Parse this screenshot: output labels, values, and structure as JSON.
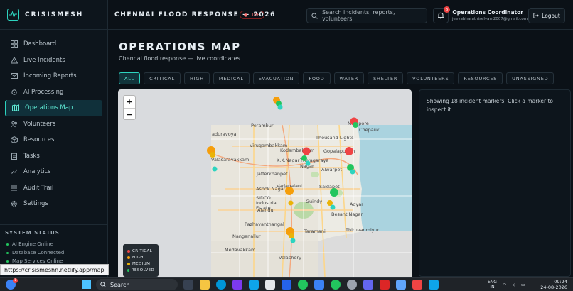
{
  "brand": {
    "name": "CRISISMESH"
  },
  "sidebar": {
    "items": [
      {
        "label": "Dashboard",
        "icon": "grid-icon"
      },
      {
        "label": "Live Incidents",
        "icon": "alert-icon"
      },
      {
        "label": "Incoming Reports",
        "icon": "inbox-icon"
      },
      {
        "label": "AI Processing",
        "icon": "cpu-icon"
      },
      {
        "label": "Operations Map",
        "icon": "map-icon",
        "active": true
      },
      {
        "label": "Volunteers",
        "icon": "users-icon"
      },
      {
        "label": "Resources",
        "icon": "box-icon"
      },
      {
        "label": "Tasks",
        "icon": "clipboard-icon"
      },
      {
        "label": "Analytics",
        "icon": "chart-icon"
      },
      {
        "label": "Audit Trail",
        "icon": "list-icon"
      },
      {
        "label": "Settings",
        "icon": "gear-icon"
      }
    ],
    "status_title": "SYSTEM STATUS",
    "status": [
      "AI Engine Online",
      "Database Connected",
      "Map Services Online"
    ]
  },
  "header": {
    "title": "CHENNAI FLOOD RESPONSE — 2026",
    "live": "LIVE",
    "search_placeholder": "Search incidents, reports, volunteers",
    "notifications": "6",
    "user_name": "Operations Coordinator",
    "user_email": "jeevabharathiselvam2007@gmail.com",
    "logout": "Logout"
  },
  "main": {
    "title": "OPERATIONS MAP",
    "subtitle": "Chennai flood response — live coordinates.",
    "filters": [
      "ALL",
      "CRITICAL",
      "HIGH",
      "MEDICAL",
      "EVACUATION",
      "FOOD",
      "WATER",
      "SHELTER",
      "VOLUNTEERS",
      "RESOURCES",
      "UNASSIGNED"
    ],
    "active_filter": "ALL",
    "info": "Showing 18 incident markers. Click a marker to inspect it.",
    "zoom_in": "+",
    "zoom_out": "−",
    "legend": [
      {
        "label": "CRITICAL",
        "color": "#ef4444"
      },
      {
        "label": "HIGH",
        "color": "#f59e0b"
      },
      {
        "label": "MEDIUM",
        "color": "#eab308"
      },
      {
        "label": "RESOLVED",
        "color": "#22c55e"
      }
    ],
    "place_labels": [
      "Perambur",
      "aduravoyal",
      "Virugambakkam",
      "Valasaravakkam",
      "Kodambakkam",
      "K.K.Nagar",
      "Thiyagaraya Nagar",
      "Alwarpet",
      "Vadapalani",
      "Saidapet",
      "Guindy",
      "Adyar",
      "Besant Nagar",
      "Thiruvanmiyur",
      "Velachery",
      "Alandur",
      "Nanganallur",
      "Medavakkam",
      "Gopalapuram",
      "Thousand Lights",
      "Mylapore",
      "Chepauk",
      "Taramani",
      "Jafferkhanpet",
      "Ashok Nagar",
      "SIDCO Industrial Estate",
      "Pazhavanthangal",
      "Virugambakkam",
      "Vadapalani"
    ]
  },
  "status_bar": {
    "url": "https://crisismeshn.netlify.app/map"
  },
  "taskbar": {
    "search": "Search",
    "badge": "1",
    "lang_top": "ENG",
    "lang_bottom": "IN",
    "time": "09:24",
    "date": "24-08-2026"
  }
}
